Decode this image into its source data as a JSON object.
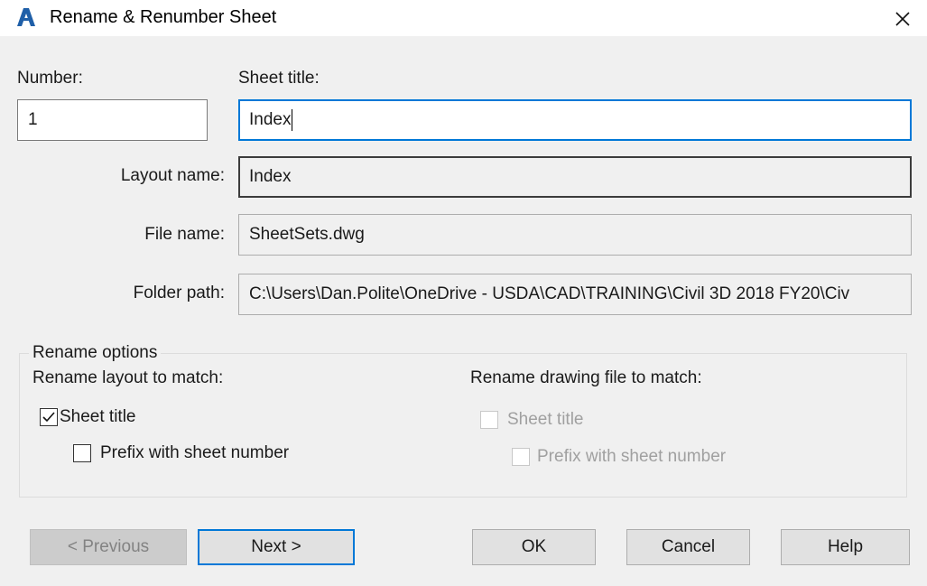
{
  "window": {
    "title": "Rename & Renumber Sheet",
    "icon": "autocad-a-icon",
    "close_icon": "close-icon"
  },
  "fields": {
    "number": {
      "label": "Number:",
      "value": "1"
    },
    "sheet_title": {
      "label": "Sheet title:",
      "value": "Index"
    },
    "layout_name": {
      "label": "Layout name:",
      "value": "Index"
    },
    "file_name": {
      "label": "File name:",
      "value": "SheetSets.dwg"
    },
    "folder_path": {
      "label": "Folder path:",
      "value": "C:\\Users\\Dan.Polite\\OneDrive - USDA\\CAD\\TRAINING\\Civil 3D 2018 FY20\\Civ"
    }
  },
  "rename_options": {
    "legend": "Rename options",
    "layout": {
      "heading": "Rename layout to match:",
      "sheet_title": {
        "label": "Sheet title",
        "checked": true,
        "enabled": true
      },
      "prefix": {
        "label": "Prefix with sheet number",
        "checked": false,
        "enabled": true
      }
    },
    "drawing": {
      "heading": "Rename drawing file to match:",
      "sheet_title": {
        "label": "Sheet title",
        "checked": false,
        "enabled": false
      },
      "prefix": {
        "label": "Prefix with sheet number",
        "checked": false,
        "enabled": false
      }
    }
  },
  "buttons": {
    "previous": {
      "label": "< Previous",
      "enabled": false
    },
    "next": {
      "label": "Next >",
      "default": true
    },
    "ok": {
      "label": "OK"
    },
    "cancel": {
      "label": "Cancel"
    },
    "help": {
      "label": "Help"
    }
  },
  "colors": {
    "accent": "#0078d7",
    "icon_blue": "#1f5fa8",
    "dialog_bg": "#f0f0f0"
  }
}
